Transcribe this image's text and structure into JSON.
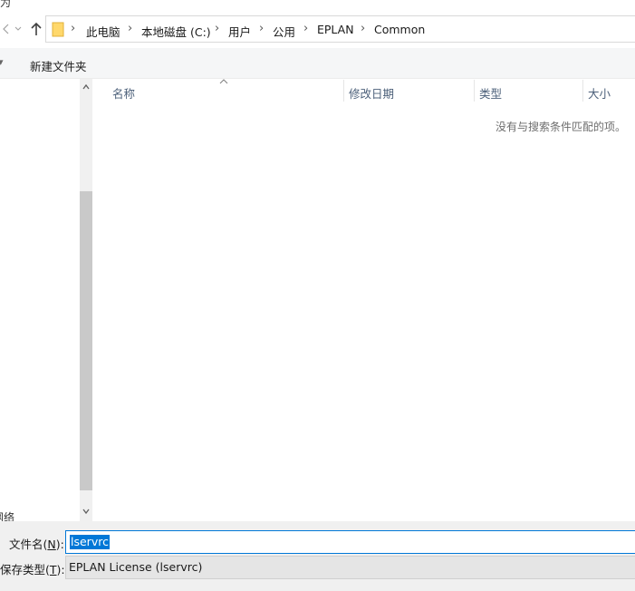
{
  "window": {
    "title_fragment": "为"
  },
  "address": {
    "back_icon": "chevron-left-icon",
    "recent_icon": "chevron-down-icon",
    "up_icon": "arrow-up-icon",
    "folder_icon": "folder-icon",
    "crumbs": [
      "此电脑",
      "本地磁盘 (C:)",
      "用户",
      "公用",
      "EPLAN",
      "Common"
    ]
  },
  "toolbar": {
    "new_folder_label": "新建文件夹",
    "organize_fragment": "▾"
  },
  "nav_pane": {
    "network_fragment": "网络"
  },
  "file_list": {
    "columns": [
      "名称",
      "修改日期",
      "类型",
      "大小"
    ],
    "empty_message": "没有与搜索条件匹配的项。"
  },
  "form": {
    "filename_label_prefix": "文件名(",
    "filename_label_key": "N",
    "filename_label_suffix": "):",
    "filename_value": "lservrc",
    "filetype_label_prefix": "保存类型(",
    "filetype_label_key": "T",
    "filetype_label_suffix": "):",
    "filetype_value": "EPLAN License (lservrc)"
  },
  "colors": {
    "accent": "#0078d7",
    "header_text": "#4c607a",
    "pane_bg": "#f0f0f0"
  }
}
